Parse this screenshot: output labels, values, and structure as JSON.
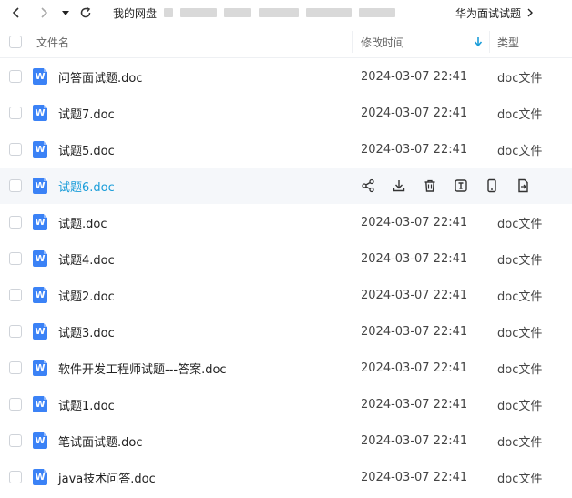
{
  "nav": {
    "back_icon": "chevron-left-icon",
    "forward_icon": "chevron-right-icon",
    "dropdown_icon": "caret-down-icon",
    "refresh_icon": "refresh-icon"
  },
  "breadcrumb": {
    "root": "我的网盘",
    "current": "华为面试试题"
  },
  "table": {
    "headers": {
      "name": "文件名",
      "modified": "修改时间",
      "type": "类型"
    },
    "sort_icon": "arrow-down-icon",
    "rows": [
      {
        "name": "问答面试题.doc",
        "modified": "2024-03-07 22:41",
        "type": "doc文件"
      },
      {
        "name": "试题7.doc",
        "modified": "2024-03-07 22:41",
        "type": "doc文件"
      },
      {
        "name": "试题5.doc",
        "modified": "2024-03-07 22:41",
        "type": "doc文件"
      },
      {
        "name": "试题6.doc",
        "modified": "",
        "type": ""
      },
      {
        "name": "试题.doc",
        "modified": "2024-03-07 22:41",
        "type": "doc文件"
      },
      {
        "name": "试题4.doc",
        "modified": "2024-03-07 22:41",
        "type": "doc文件"
      },
      {
        "name": "试题2.doc",
        "modified": "2024-03-07 22:41",
        "type": "doc文件"
      },
      {
        "name": "试题3.doc",
        "modified": "2024-03-07 22:41",
        "type": "doc文件"
      },
      {
        "name": "软件开发工程师试题---答案.doc",
        "modified": "2024-03-07 22:41",
        "type": "doc文件"
      },
      {
        "name": "试题1.doc",
        "modified": "2024-03-07 22:41",
        "type": "doc文件"
      },
      {
        "name": "笔试面试题.doc",
        "modified": "2024-03-07 22:41",
        "type": "doc文件"
      },
      {
        "name": "java技术问答.doc",
        "modified": "2024-03-07 22:41",
        "type": "doc文件"
      }
    ]
  },
  "hover_actions": [
    "share-icon",
    "download-icon",
    "delete-icon",
    "text-recognition-icon",
    "phone-icon",
    "copy-file-icon"
  ],
  "file_icon_letter": "W",
  "colors": {
    "accent": "#1a9dd9",
    "file_icon": "#3b82f6",
    "hover_row": "#f5f7fa"
  }
}
